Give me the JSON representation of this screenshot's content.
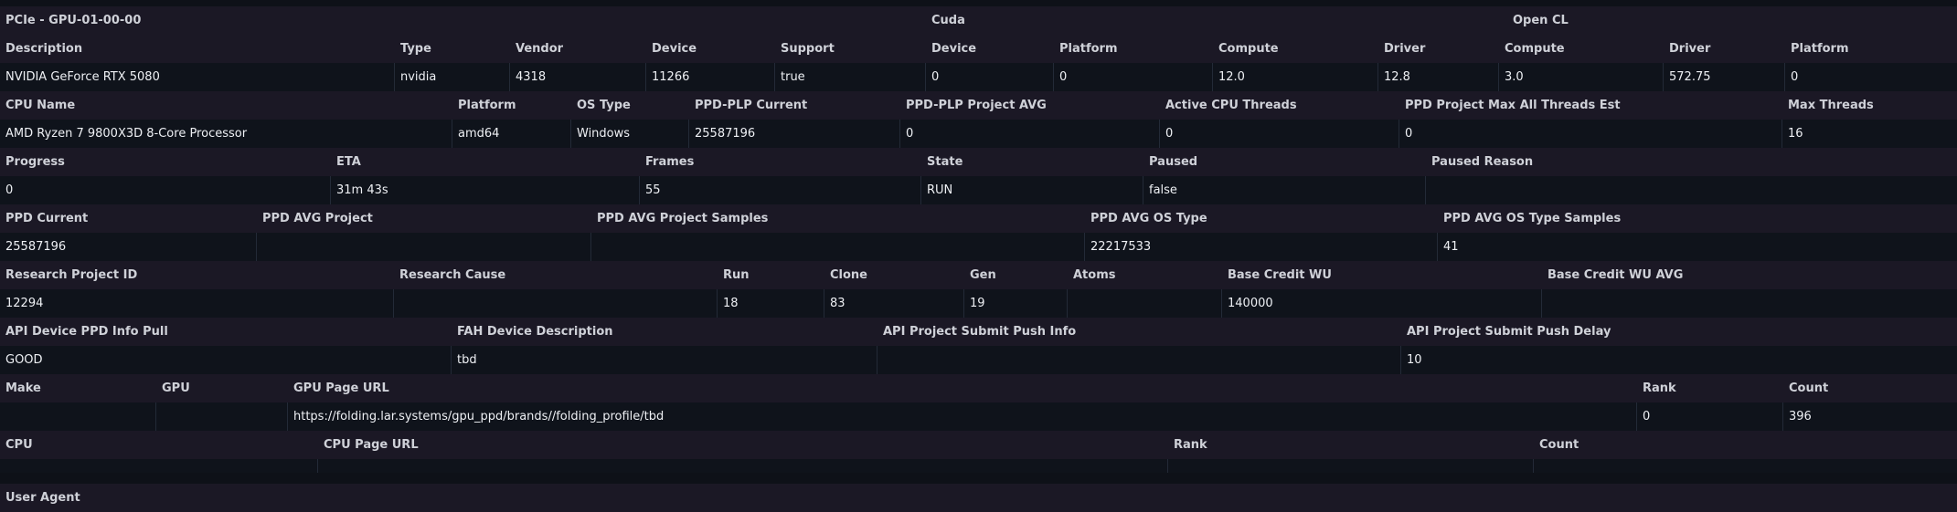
{
  "pcie": {
    "title": "PCIe - GPU-01-00-00",
    "cuda_title": "Cuda",
    "opencl_title": "Open CL",
    "headers": [
      "Description",
      "Type",
      "Vendor",
      "Device",
      "Support",
      "Device",
      "Platform",
      "Compute",
      "Driver",
      "Compute",
      "Driver",
      "Platform"
    ],
    "values": [
      "NVIDIA GeForce RTX 5080",
      "nvidia",
      "4318",
      "11266",
      "true",
      "0",
      "0",
      "12.0",
      "12.8",
      "3.0",
      "572.75",
      "0"
    ]
  },
  "cpu": {
    "headers": [
      "CPU Name",
      "Platform",
      "OS Type",
      "PPD-PLP Current",
      "PPD-PLP Project AVG",
      "Active CPU Threads",
      "PPD Project Max All Threads Est",
      "Max Threads"
    ],
    "values": [
      "AMD Ryzen 7 9800X3D 8-Core Processor",
      "amd64",
      "Windows",
      "25587196",
      "0",
      "0",
      "0",
      "16"
    ]
  },
  "progress": {
    "headers": [
      "Progress",
      "ETA",
      "Frames",
      "State",
      "Paused",
      "Paused Reason"
    ],
    "values": [
      "0",
      "31m 43s",
      "55",
      "RUN",
      "false",
      ""
    ]
  },
  "ppd": {
    "headers": [
      "PPD Current",
      "PPD AVG Project",
      "PPD AVG Project Samples",
      "PPD AVG OS Type",
      "PPD AVG OS Type Samples"
    ],
    "values": [
      "25587196",
      "",
      "",
      "22217533",
      "41"
    ]
  },
  "research": {
    "headers": [
      "Research Project ID",
      "Research Cause",
      "Run",
      "Clone",
      "Gen",
      "Atoms",
      "Base Credit WU",
      "Base Credit WU AVG"
    ],
    "values": [
      "12294",
      "",
      "18",
      "83",
      "19",
      "",
      "140000",
      ""
    ]
  },
  "api": {
    "headers": [
      "API Device PPD Info Pull",
      "FAH Device Description",
      "API Project Submit Push Info",
      "API Project Submit Push Delay"
    ],
    "values": [
      "GOOD",
      "tbd",
      "",
      "10"
    ]
  },
  "gpu_page": {
    "headers": [
      "Make",
      "GPU",
      "GPU Page URL",
      "Rank",
      "Count"
    ],
    "values": [
      "",
      "",
      "https://folding.lar.systems/gpu_ppd/brands//folding_profile/tbd",
      "0",
      "396"
    ]
  },
  "cpu_page": {
    "headers": [
      "CPU",
      "CPU Page URL",
      "Rank",
      "Count"
    ],
    "values": [
      "",
      "",
      "",
      ""
    ]
  },
  "user_agent": {
    "header": "User Agent"
  }
}
